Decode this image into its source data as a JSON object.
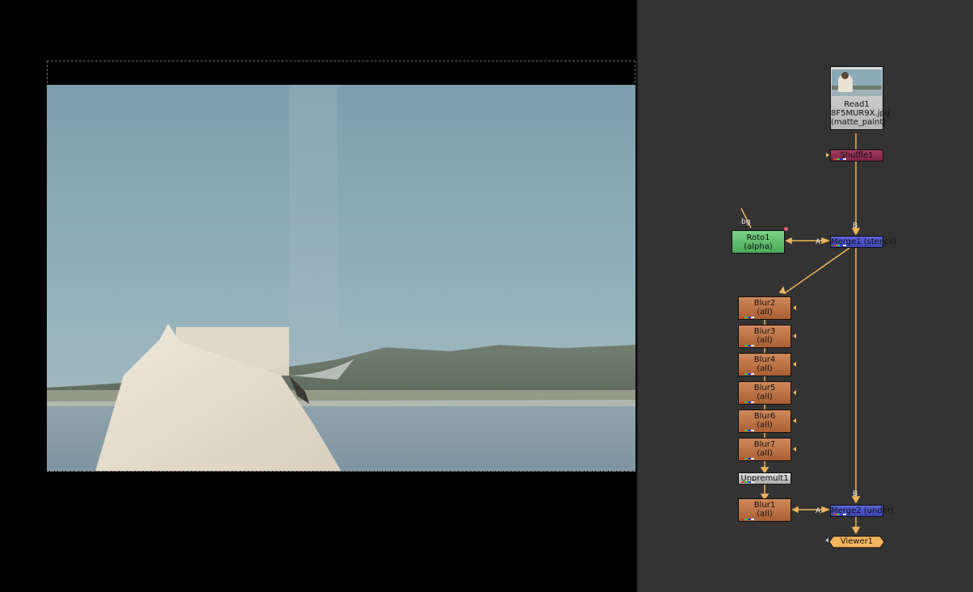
{
  "viewer": {
    "image_title": "Composited plate: cleaned-up matte painting of a lake with a person in a white shirt"
  },
  "nodes": {
    "read": {
      "name": "Read1",
      "file": "8F5MUR9X.jpg",
      "layer": "(matte_paint)"
    },
    "shuffle": {
      "name": "Shuffle1"
    },
    "roto": {
      "name": "Roto1",
      "channels": "(alpha)",
      "input_label": "bg"
    },
    "merge1": {
      "name": "Merge1 (stencil)",
      "input_a": "A",
      "input_b": "B"
    },
    "blurs": [
      {
        "name": "Blur2",
        "channels": "(all)"
      },
      {
        "name": "Blur3",
        "channels": "(all)"
      },
      {
        "name": "Blur4",
        "channels": "(all)"
      },
      {
        "name": "Blur5",
        "channels": "(all)"
      },
      {
        "name": "Blur6",
        "channels": "(all)"
      },
      {
        "name": "Blur7",
        "channels": "(all)"
      }
    ],
    "unpremult": {
      "name": "Unpremult1"
    },
    "blur1": {
      "name": "Blur1",
      "channels": "(all)"
    },
    "merge2": {
      "name": "Merge2 (under)",
      "input_a": "A",
      "input_b": "B"
    },
    "viewer": {
      "name": "Viewer1"
    }
  },
  "colors": {
    "blur_node": "#c07443",
    "merge_node": "#4a52c8",
    "roto_node": "#5fbf6a",
    "shuffle_node": "#8e2a50",
    "connection": "#f1b45b",
    "graph_bg": "#333333"
  }
}
